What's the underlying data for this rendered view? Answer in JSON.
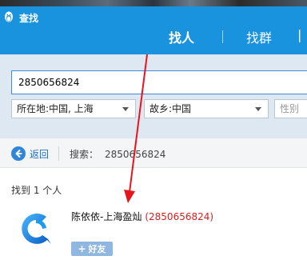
{
  "window": {
    "title": "查找"
  },
  "tabs": [
    {
      "label": "找人",
      "active": true
    },
    {
      "label": "找群",
      "active": false
    }
  ],
  "search": {
    "value": "2850656824",
    "location_label": "所在地:中国, 上海",
    "hometown_label": "故乡:中国",
    "gender_placeholder": "性别"
  },
  "nav": {
    "back_label": "返回",
    "search_prefix": "搜索：",
    "search_value": "2850656824"
  },
  "results": {
    "count_label": "找到 1 个人",
    "items": [
      {
        "name": "陈依依-上海盈灿",
        "qq_number": "(2850656824)",
        "add_button": "好友"
      }
    ]
  },
  "colors": {
    "header_blue": "#1a93df",
    "panel_bg": "#dde8f2",
    "qq_number_red": "#d91e1e",
    "annotation_red": "#e8141b",
    "add_button_bg": "#8fb7e0"
  },
  "icons": {
    "app": "qq-penguin-icon",
    "back": "back-arrow-icon",
    "avatar": "blue-c-logo-icon",
    "add": "plus-icon"
  }
}
